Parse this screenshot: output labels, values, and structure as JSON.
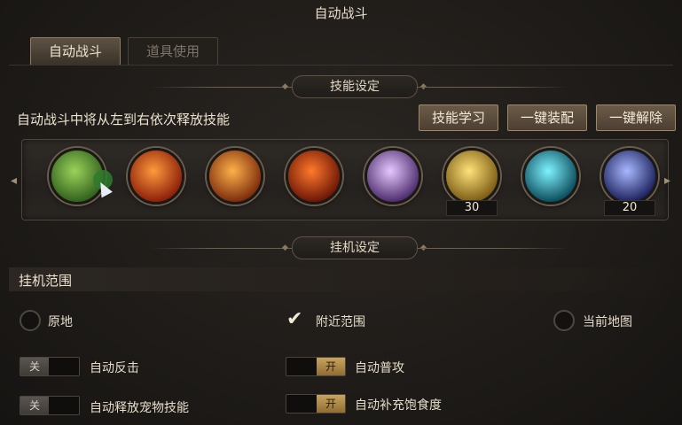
{
  "window": {
    "title": "自动战斗"
  },
  "tabs": [
    {
      "label": "自动战斗",
      "active": true
    },
    {
      "label": "道具使用",
      "active": false
    }
  ],
  "skills_section": {
    "header": "技能设定",
    "caption": "自动战斗中将从左到右依次释放技能",
    "buttons": {
      "learn": "技能学习",
      "equip_all": "一键装配",
      "unequip_all": "一键解除"
    },
    "skills": [
      {
        "icon": "serpent-skill-icon",
        "colors": [
          "#9bd35a",
          "#2f5f1c"
        ],
        "count": ""
      },
      {
        "icon": "fire-slash-skill-icon",
        "colors": [
          "#ff9a3c",
          "#8a1d08"
        ],
        "count": ""
      },
      {
        "icon": "flame-warrior-skill-icon",
        "colors": [
          "#ffb14a",
          "#7a2a0a"
        ],
        "count": ""
      },
      {
        "icon": "fire-strike-skill-icon",
        "colors": [
          "#ff7a2a",
          "#6a1406"
        ],
        "count": ""
      },
      {
        "icon": "arcane-chain-skill-icon",
        "colors": [
          "#e6c8ff",
          "#4a2a6a"
        ],
        "count": ""
      },
      {
        "icon": "golden-shield-skill-icon",
        "colors": [
          "#ffe27a",
          "#7a5a12"
        ],
        "count": "30"
      },
      {
        "icon": "cyan-rune-skill-icon",
        "colors": [
          "#7ff3ff",
          "#0a4a5a"
        ],
        "count": ""
      },
      {
        "icon": "spirit-portrait-skill-icon",
        "colors": [
          "#a8b8ff",
          "#1a1f5a"
        ],
        "count": "20"
      }
    ]
  },
  "idle_section": {
    "header": "挂机设定",
    "range_label": "挂机范围",
    "range_options": [
      {
        "label": "原地",
        "selected": false
      },
      {
        "label": "附近范围",
        "selected": true
      },
      {
        "label": "当前地图",
        "selected": false
      }
    ],
    "toggles": [
      {
        "label": "自动反击",
        "state": "off",
        "text": "关"
      },
      {
        "label": "自动普攻",
        "state": "on",
        "text": "开"
      },
      {
        "label": "自动释放宠物技能",
        "state": "off",
        "text": "关"
      },
      {
        "label": "自动补充饱食度",
        "state": "on",
        "text": "开"
      }
    ]
  }
}
